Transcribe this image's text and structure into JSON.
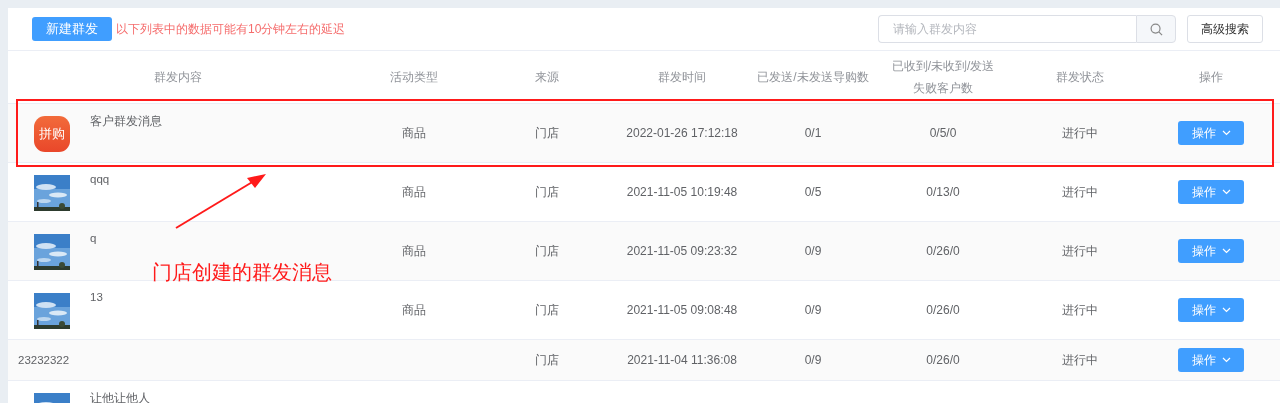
{
  "toolbar": {
    "new_button": "新建群发",
    "notice": "以下列表中的数据可能有10分钟左右的延迟",
    "search": {
      "placeholder": "请输入群发内容"
    },
    "advanced_button": "高级搜索"
  },
  "table": {
    "columns": [
      "群发内容",
      "活动类型",
      "来源",
      "群发时间",
      "已发送/未发送导购数",
      "已收到/未收到/发送失败客户数",
      "群发状态",
      "操作"
    ],
    "rows": [
      {
        "thumb": {
          "kind": "logo",
          "text": "拼购"
        },
        "title": "客户群发消息",
        "activity_type": "商品",
        "source": "门店",
        "time": "2022-01-26 17:12:18",
        "sent": "0/1",
        "received": "0/5/0",
        "status": "进行中",
        "action": "操作",
        "highlighted": true
      },
      {
        "title": "qqq",
        "activity_type": "商品",
        "source": "门店",
        "time": "2021-11-05 10:19:48",
        "sent": "0/5",
        "received": "0/13/0",
        "status": "进行中",
        "action": "操作",
        "highlighted": false
      },
      {
        "title": "q",
        "activity_type": "商品",
        "source": "门店",
        "time": "2021-11-05 09:23:32",
        "sent": "0/9",
        "received": "0/26/0",
        "status": "进行中",
        "action": "操作",
        "highlighted": false
      },
      {
        "title": "13",
        "activity_type": "商品",
        "source": "门店",
        "time": "2021-11-05 09:08:48",
        "sent": "0/9",
        "received": "0/26/0",
        "status": "进行中",
        "action": "操作",
        "highlighted": false
      },
      {
        "title": "23232322",
        "source": "门店",
        "time": "2021-11-04 11:36:08",
        "sent": "0/9",
        "received": "0/26/0",
        "status": "进行中",
        "action": "操作",
        "highlighted": false
      },
      {
        "title": "让他让他人",
        "highlighted": false
      }
    ]
  },
  "annotation": {
    "text": "门店创建的群发消息"
  }
}
